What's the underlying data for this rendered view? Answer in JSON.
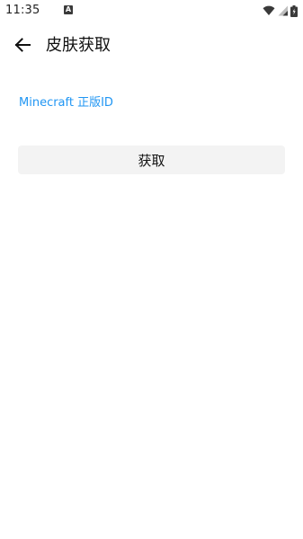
{
  "status_bar": {
    "time": "11:35",
    "notification_icon": "A",
    "icons": [
      "wifi-icon",
      "signal-icon",
      "battery-icon"
    ]
  },
  "app_bar": {
    "back_icon": "arrow-left-icon",
    "title": "皮肤获取"
  },
  "form": {
    "id_label": "Minecraft 正版ID",
    "fetch_button_label": "获取"
  },
  "colors": {
    "accent": "#2196f3",
    "button_bg": "#f3f3f3",
    "background": "#ffffff",
    "text": "#111111"
  }
}
